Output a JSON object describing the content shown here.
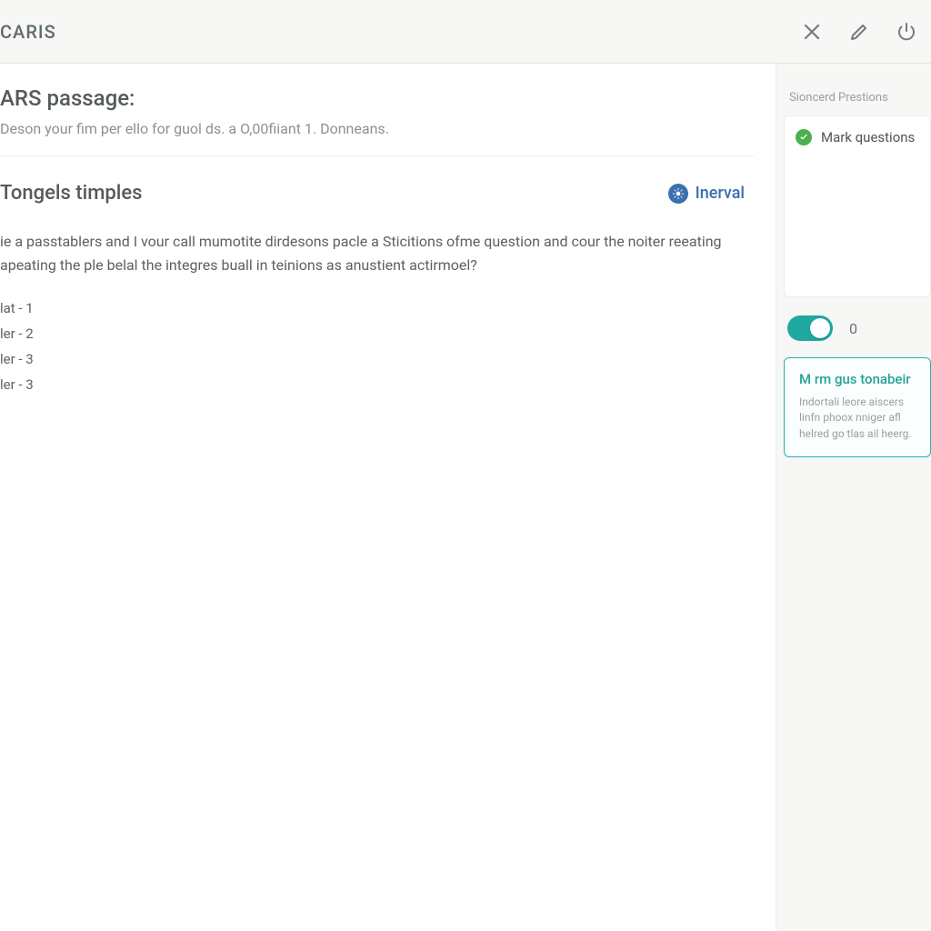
{
  "header": {
    "brand": "CARIS"
  },
  "passage": {
    "title": "ARS passage:",
    "subtitle": "Deson your fim per ello for guol ds. a O,00fiiant 1. Donneans."
  },
  "question": {
    "title": "Tongels timples",
    "interval_label": "Inerval",
    "body": "ie a passtablers and I vour call mumotite dirdesons pacle a Sticitions ofme question and cour the noiter reeating apeating the ple belal the integres buall in teinions as anustient actirmoel?",
    "answers": [
      {
        "label": "lat - 1"
      },
      {
        "label": "ler - 2"
      },
      {
        "label": "ler - 3"
      },
      {
        "label": "ler - 3"
      }
    ]
  },
  "sidebar": {
    "section_title": "Sioncerd Prestions",
    "mark_label": "Mark questions",
    "toggle_value": "0",
    "tip": {
      "title": "M rm gus tonabeir",
      "body": "Indortali leore aiscers linfn phoox nniger afl helred go tlas ail heerg."
    }
  }
}
